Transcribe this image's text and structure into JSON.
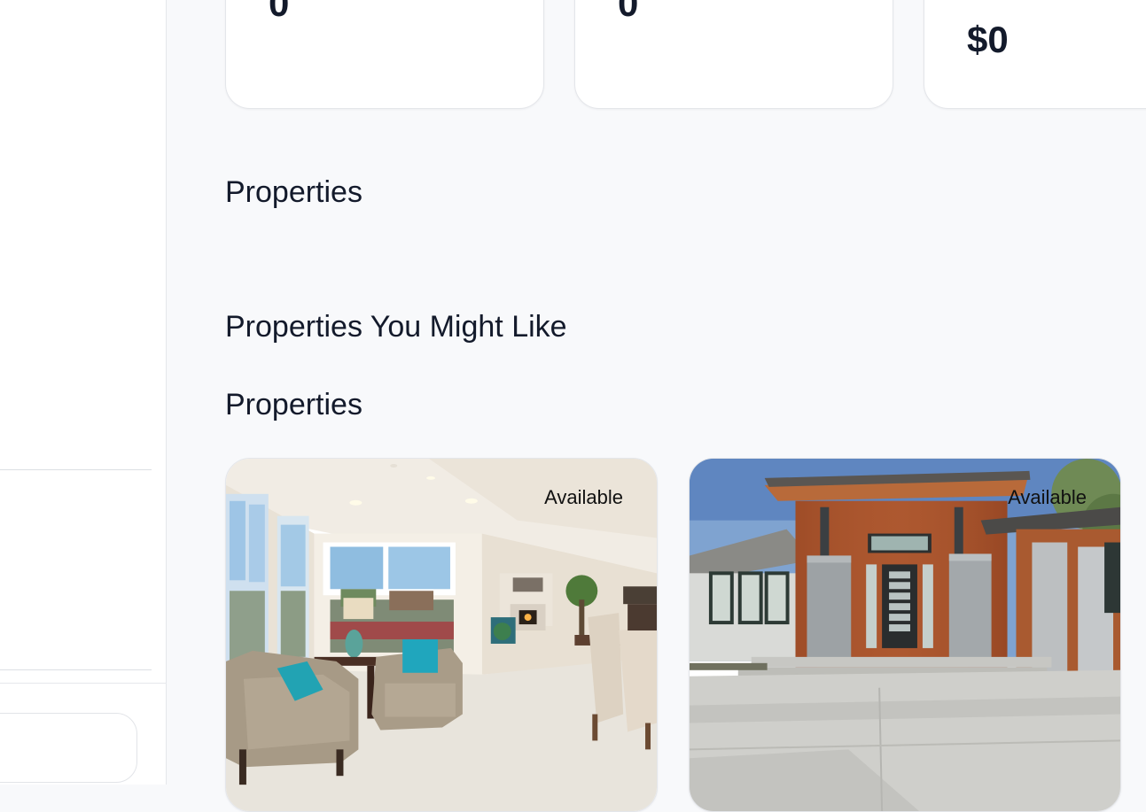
{
  "stats": [
    {
      "value": "0"
    },
    {
      "value": "0"
    },
    {
      "value": "$0"
    }
  ],
  "sections": {
    "properties_title": "Properties",
    "recommended_title": "Properties You Might Like",
    "properties_list_title": "Properties"
  },
  "property_cards": [
    {
      "status": "Available",
      "image_icon": "living-room-photo"
    },
    {
      "status": "Available",
      "image_icon": "house-exterior-photo"
    }
  ],
  "colors": {
    "page_bg": "#f8f9fb",
    "card_bg": "#ffffff",
    "text_primary": "#131a2b",
    "border": "#e4e6ea"
  }
}
